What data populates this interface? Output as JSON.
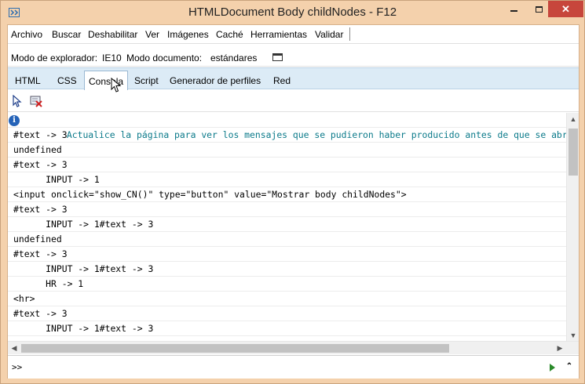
{
  "window": {
    "title": "HTMLDocument Body childNodes - F12"
  },
  "menu": [
    "Archivo",
    "Buscar",
    "Deshabilitar",
    "Ver",
    "Imágenes",
    "Caché",
    "Herramientas",
    "Validar"
  ],
  "mode_bar": {
    "browser_mode_label": "Modo de explorador:",
    "browser_mode_value": "IE10",
    "document_mode_label": "Modo documento:",
    "document_mode_value": "estándares"
  },
  "tabs": [
    "HTML",
    "CSS",
    "Consola",
    "Script",
    "Generador de perfiles",
    "Red"
  ],
  "active_tab": "Consola",
  "console": {
    "info_message": "Actualice la página para ver los mensajes que se pudieron haber producido antes de que se abrieran",
    "lines": [
      "#text -> 3",
      "undefined",
      "#text -> 3",
      "      INPUT -> 1",
      "<input onclick=\"show_CN()\" type=\"button\" value=\"Mostrar body childNodes\">",
      "#text -> 3",
      "      INPUT -> 1#text -> 3",
      "undefined",
      "#text -> 3",
      "      INPUT -> 1#text -> 3",
      "      HR -> 1",
      "<hr>",
      "#text -> 3",
      "      INPUT -> 1#text -> 3"
    ]
  },
  "input": {
    "prompt": ">>",
    "value": ""
  },
  "colors": {
    "titlebar": "#f4d1ac",
    "tabbar": "#dcebf6",
    "info_text": "#0b7a8a",
    "close_button": "#c7463c"
  }
}
